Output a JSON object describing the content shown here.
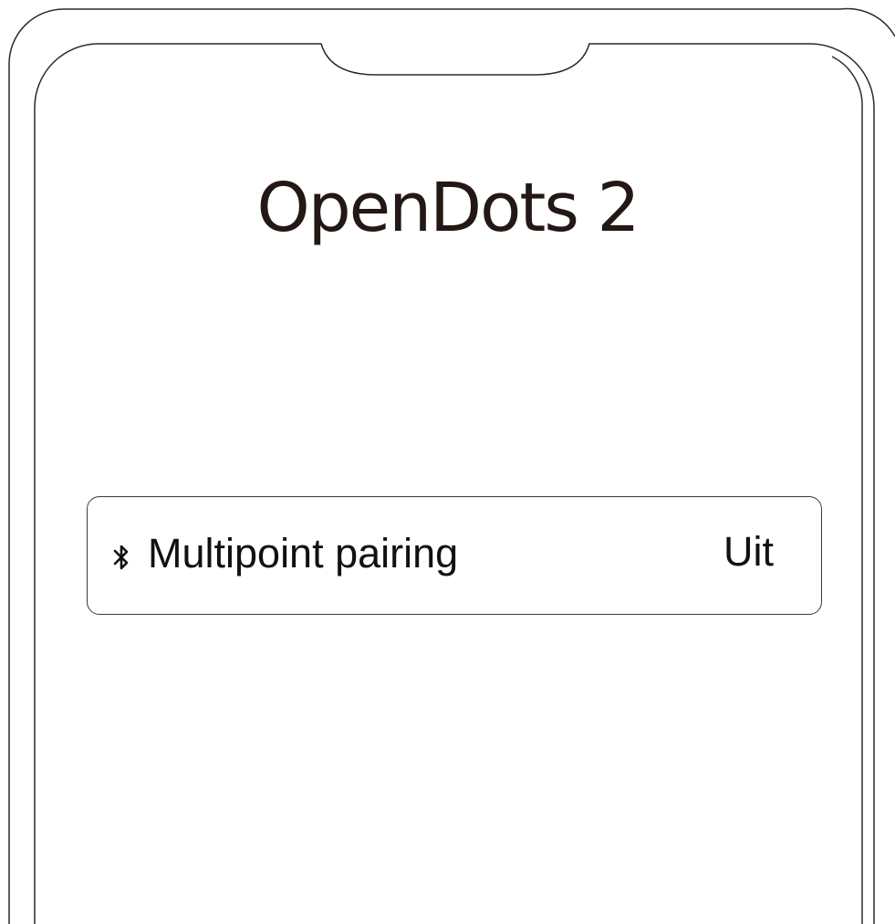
{
  "device": {
    "title": "OpenDots 2"
  },
  "settings": {
    "multipoint": {
      "icon": "bluetooth-icon",
      "label": "Multipoint pairing",
      "value": "Uit"
    }
  },
  "colors": {
    "title": "#231815",
    "text": "#111111",
    "outline": "#3a3a3a"
  }
}
